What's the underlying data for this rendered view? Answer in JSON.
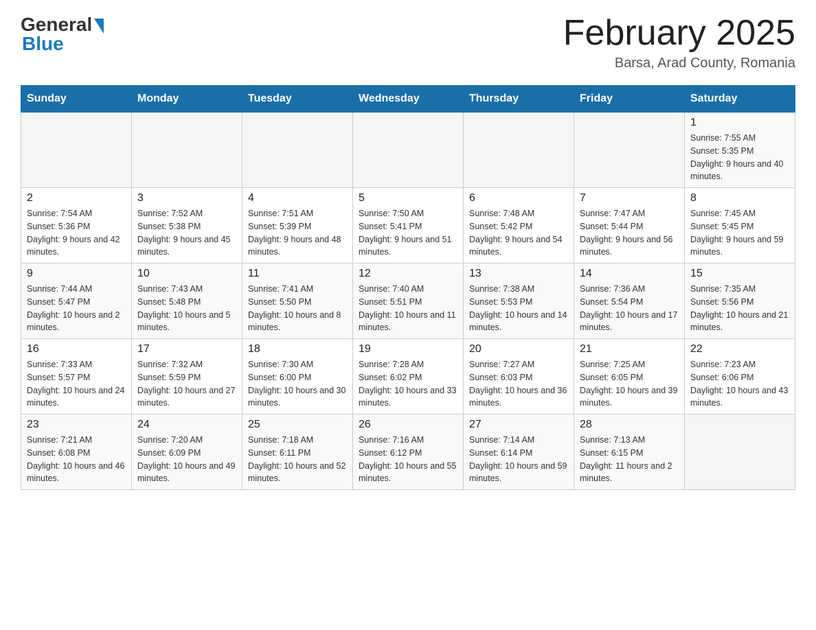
{
  "logo": {
    "general": "General",
    "blue": "Blue"
  },
  "title": {
    "month": "February 2025",
    "location": "Barsa, Arad County, Romania"
  },
  "weekdays": [
    "Sunday",
    "Monday",
    "Tuesday",
    "Wednesday",
    "Thursday",
    "Friday",
    "Saturday"
  ],
  "weeks": [
    [
      {
        "day": "",
        "info": ""
      },
      {
        "day": "",
        "info": ""
      },
      {
        "day": "",
        "info": ""
      },
      {
        "day": "",
        "info": ""
      },
      {
        "day": "",
        "info": ""
      },
      {
        "day": "",
        "info": ""
      },
      {
        "day": "1",
        "info": "Sunrise: 7:55 AM\nSunset: 5:35 PM\nDaylight: 9 hours and 40 minutes."
      }
    ],
    [
      {
        "day": "2",
        "info": "Sunrise: 7:54 AM\nSunset: 5:36 PM\nDaylight: 9 hours and 42 minutes."
      },
      {
        "day": "3",
        "info": "Sunrise: 7:52 AM\nSunset: 5:38 PM\nDaylight: 9 hours and 45 minutes."
      },
      {
        "day": "4",
        "info": "Sunrise: 7:51 AM\nSunset: 5:39 PM\nDaylight: 9 hours and 48 minutes."
      },
      {
        "day": "5",
        "info": "Sunrise: 7:50 AM\nSunset: 5:41 PM\nDaylight: 9 hours and 51 minutes."
      },
      {
        "day": "6",
        "info": "Sunrise: 7:48 AM\nSunset: 5:42 PM\nDaylight: 9 hours and 54 minutes."
      },
      {
        "day": "7",
        "info": "Sunrise: 7:47 AM\nSunset: 5:44 PM\nDaylight: 9 hours and 56 minutes."
      },
      {
        "day": "8",
        "info": "Sunrise: 7:45 AM\nSunset: 5:45 PM\nDaylight: 9 hours and 59 minutes."
      }
    ],
    [
      {
        "day": "9",
        "info": "Sunrise: 7:44 AM\nSunset: 5:47 PM\nDaylight: 10 hours and 2 minutes."
      },
      {
        "day": "10",
        "info": "Sunrise: 7:43 AM\nSunset: 5:48 PM\nDaylight: 10 hours and 5 minutes."
      },
      {
        "day": "11",
        "info": "Sunrise: 7:41 AM\nSunset: 5:50 PM\nDaylight: 10 hours and 8 minutes."
      },
      {
        "day": "12",
        "info": "Sunrise: 7:40 AM\nSunset: 5:51 PM\nDaylight: 10 hours and 11 minutes."
      },
      {
        "day": "13",
        "info": "Sunrise: 7:38 AM\nSunset: 5:53 PM\nDaylight: 10 hours and 14 minutes."
      },
      {
        "day": "14",
        "info": "Sunrise: 7:36 AM\nSunset: 5:54 PM\nDaylight: 10 hours and 17 minutes."
      },
      {
        "day": "15",
        "info": "Sunrise: 7:35 AM\nSunset: 5:56 PM\nDaylight: 10 hours and 21 minutes."
      }
    ],
    [
      {
        "day": "16",
        "info": "Sunrise: 7:33 AM\nSunset: 5:57 PM\nDaylight: 10 hours and 24 minutes."
      },
      {
        "day": "17",
        "info": "Sunrise: 7:32 AM\nSunset: 5:59 PM\nDaylight: 10 hours and 27 minutes."
      },
      {
        "day": "18",
        "info": "Sunrise: 7:30 AM\nSunset: 6:00 PM\nDaylight: 10 hours and 30 minutes."
      },
      {
        "day": "19",
        "info": "Sunrise: 7:28 AM\nSunset: 6:02 PM\nDaylight: 10 hours and 33 minutes."
      },
      {
        "day": "20",
        "info": "Sunrise: 7:27 AM\nSunset: 6:03 PM\nDaylight: 10 hours and 36 minutes."
      },
      {
        "day": "21",
        "info": "Sunrise: 7:25 AM\nSunset: 6:05 PM\nDaylight: 10 hours and 39 minutes."
      },
      {
        "day": "22",
        "info": "Sunrise: 7:23 AM\nSunset: 6:06 PM\nDaylight: 10 hours and 43 minutes."
      }
    ],
    [
      {
        "day": "23",
        "info": "Sunrise: 7:21 AM\nSunset: 6:08 PM\nDaylight: 10 hours and 46 minutes."
      },
      {
        "day": "24",
        "info": "Sunrise: 7:20 AM\nSunset: 6:09 PM\nDaylight: 10 hours and 49 minutes."
      },
      {
        "day": "25",
        "info": "Sunrise: 7:18 AM\nSunset: 6:11 PM\nDaylight: 10 hours and 52 minutes."
      },
      {
        "day": "26",
        "info": "Sunrise: 7:16 AM\nSunset: 6:12 PM\nDaylight: 10 hours and 55 minutes."
      },
      {
        "day": "27",
        "info": "Sunrise: 7:14 AM\nSunset: 6:14 PM\nDaylight: 10 hours and 59 minutes."
      },
      {
        "day": "28",
        "info": "Sunrise: 7:13 AM\nSunset: 6:15 PM\nDaylight: 11 hours and 2 minutes."
      },
      {
        "day": "",
        "info": ""
      }
    ]
  ]
}
